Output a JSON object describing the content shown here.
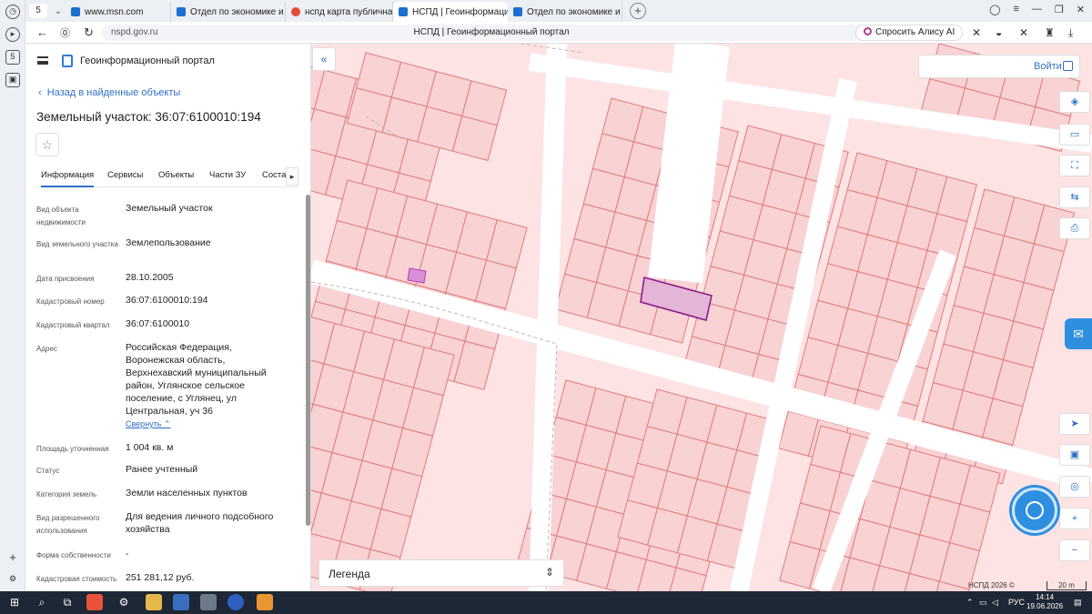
{
  "browser": {
    "tab_count": "5",
    "tabs": [
      {
        "label": "www.msn.com",
        "fav_color": "#1b6fd1"
      },
      {
        "label": "Отдел по экономике и уп",
        "fav_color": "#1b6fd1"
      },
      {
        "label": "нспд карта публичная ка",
        "fav_color": "#e34a3a"
      },
      {
        "label": "НСПД | Геоинформацио",
        "fav_color": "#1b6fd1",
        "active": true
      },
      {
        "label": "Отдел по экономике и уп",
        "fav_color": "#1b6fd1"
      }
    ],
    "url": "nspd.gov.ru",
    "page_title": "НСПД | Геоинформационный портал",
    "alice_label": "Спросить Алису AI"
  },
  "panel": {
    "portal_title": "Геоинформационный портал",
    "back_label": "Назад в найденные объекты",
    "parcel_title": "Земельный участок: 36:07:6100010:194",
    "tabs": [
      "Информация",
      "Сервисы",
      "Объекты",
      "Части ЗУ",
      "Состав"
    ],
    "fields": [
      {
        "label": "Вид объекта недвижимости",
        "value": "Земельный участок"
      },
      {
        "label": "Вид земельного участка",
        "value": "Землепользование"
      },
      {
        "label": "Дата присвоения",
        "value": "28.10.2005"
      },
      {
        "label": "Кадастровый номер",
        "value": "36:07:6100010:194"
      },
      {
        "label": "Кадастровый квартал",
        "value": "36:07:6100010"
      },
      {
        "label": "Адрес",
        "value": "Российская Федерация, Воронежская область, Верхнехавский муниципальный район, Углянское сельское поселение, с Углянец, ул Центральная, уч 36"
      },
      {
        "label": "Площадь уточненная",
        "value": "1 004 кв. м"
      },
      {
        "label": "Статус",
        "value": "Ранее учтенный"
      },
      {
        "label": "Категория земель",
        "value": "Земли населенных пунктов"
      },
      {
        "label": "Вид разрешенного использования",
        "value": "Для ведения личного подсобного хозяйства"
      },
      {
        "label": "Форма собственности",
        "value": "-"
      },
      {
        "label": "Кадастровая стоимость",
        "value": "251 281,12 руб."
      }
    ],
    "collapse_label": "Свернуть"
  },
  "map": {
    "login_label": "Войти",
    "legend_label": "Легенда",
    "copyright": "НСПД 2026 ©",
    "scale": "20 m",
    "colors": {
      "parcel_fill": "#f9d2d4",
      "parcel_line": "#e07a7a",
      "selected_fill": "#e4b5d6",
      "selected_line": "#8b1d8b",
      "road": "#ffffff",
      "accent": "#2e6fc4"
    }
  },
  "taskbar": {
    "lang": "РУС",
    "time": "14:14",
    "date": "19.06.2026"
  }
}
